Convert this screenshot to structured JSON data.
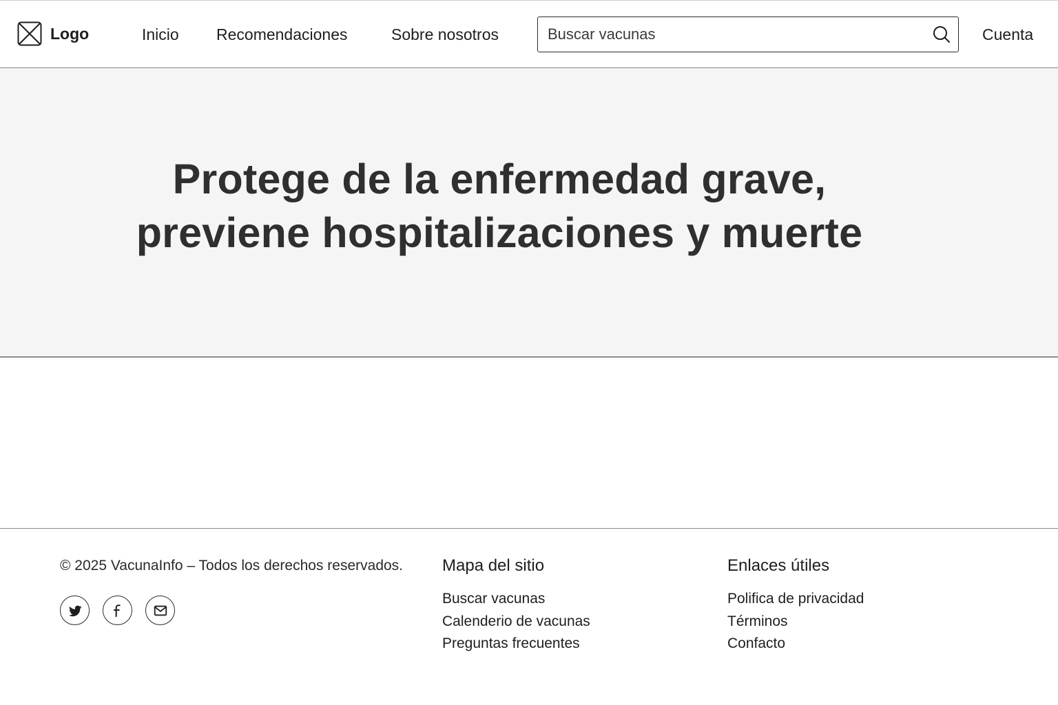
{
  "header": {
    "logo_text": "Logo",
    "nav": [
      {
        "label": "Inicio"
      },
      {
        "label": "Recomendaciones"
      },
      {
        "label": "Sobre nosotros"
      }
    ],
    "search": {
      "placeholder": "Buscar vacunas",
      "value": ""
    },
    "account_label": "Cuenta"
  },
  "hero": {
    "title_line1": "Protege de la enfermedad grave,",
    "title_line2": "previene hospitalizaciones y muerte"
  },
  "footer": {
    "copyright": "© 2025 VacunaInfo – Todos los derechos reservados.",
    "socials": [
      "twitter-icon",
      "facebook-icon",
      "mail-icon"
    ],
    "sitemap": {
      "title": "Mapa del sitio",
      "links": [
        "Buscar vacunas",
        "Calenderio de vacunas",
        "Preguntas frecuentes"
      ]
    },
    "useful_links": {
      "title": "Enlaces útiles",
      "links": [
        "Polifica de privacidad",
        "Términos",
        "Confacto"
      ]
    }
  },
  "colors": {
    "text": "#1e1e1e",
    "hero_background": "#f5f5f5",
    "border": "#2a2a2a"
  }
}
